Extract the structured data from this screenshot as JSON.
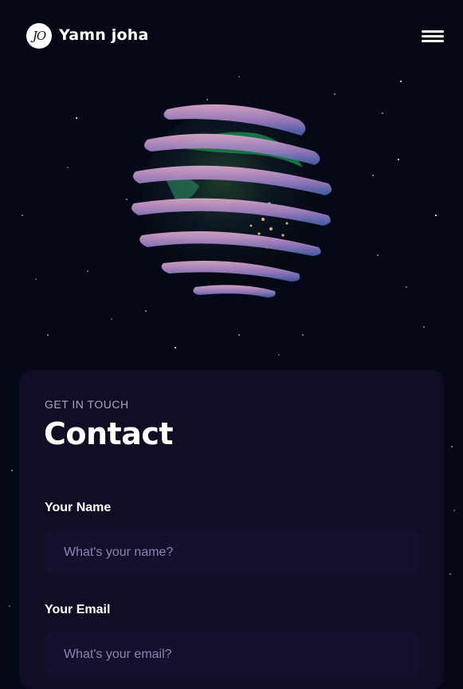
{
  "header": {
    "logo_initials": "JO",
    "brand_name": "Yamn  joha"
  },
  "contact": {
    "eyebrow": "GET IN TOUCH",
    "title": "Contact",
    "name_label": "Your Name",
    "name_placeholder": "What's your name?",
    "name_value": "",
    "email_label": "Your Email",
    "email_placeholder": "What's your email?",
    "email_value": ""
  },
  "colors": {
    "background": "#050816",
    "card": "#100d25",
    "input": "#151030",
    "eyebrow": "#aaa6c3"
  },
  "icons": {
    "menu": "hamburger-menu-icon",
    "globe": "earth-globe-illustration"
  }
}
